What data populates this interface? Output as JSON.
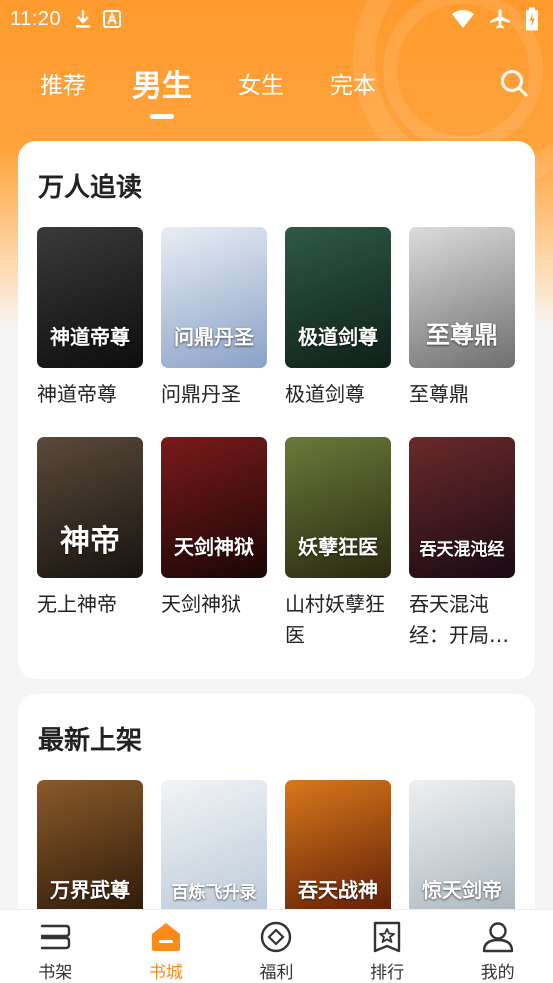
{
  "status_bar": {
    "time": "11:20",
    "left_icons": [
      "download-icon",
      "a-badge-icon"
    ],
    "right_icons": [
      "wifi-icon",
      "airplane-icon",
      "battery-icon"
    ]
  },
  "top_tabs": [
    {
      "label": "推荐",
      "active": false
    },
    {
      "label": "男生",
      "active": true
    },
    {
      "label": "女生",
      "active": false
    },
    {
      "label": "完本",
      "active": false
    }
  ],
  "colors": {
    "accent": "#ff8a1a",
    "header_gradient_top": "#ff9a2e",
    "background": "#f5f5f5"
  },
  "sections": [
    {
      "title": "万人追读",
      "books": [
        {
          "title": "神道帝尊",
          "cover_text": "神道帝尊",
          "cover_colors": [
            "#3a3a3a",
            "#0d0d0d"
          ]
        },
        {
          "title": "问鼎丹圣",
          "cover_text": "问鼎丹圣",
          "cover_colors": [
            "#e9eef4",
            "#8aa1c6"
          ]
        },
        {
          "title": "极道剑尊",
          "cover_text": "极道剑尊",
          "cover_colors": [
            "#2e5a46",
            "#0e2018"
          ]
        },
        {
          "title": "至尊鼎",
          "cover_text": "至尊鼎",
          "cover_colors": [
            "#dcdcdc",
            "#6f6f6f"
          ]
        },
        {
          "title": "无上神帝",
          "cover_text": "神帝",
          "cover_colors": [
            "#5a4a3a",
            "#181410"
          ]
        },
        {
          "title": "天剑神狱",
          "cover_text": "天剑神狱",
          "cover_colors": [
            "#7a1a1a",
            "#1a0606"
          ]
        },
        {
          "title": "山村妖孽狂医",
          "cover_text": "妖孽狂医",
          "cover_colors": [
            "#6a7a3a",
            "#2a2a10"
          ]
        },
        {
          "title": "吞天混沌经：开局…",
          "cover_text": "吞天混沌经",
          "cover_colors": [
            "#6a2a2a",
            "#1a0a14"
          ]
        }
      ]
    },
    {
      "title": "最新上架",
      "books": [
        {
          "title": "万界武尊",
          "cover_text": "万界武尊",
          "cover_colors": [
            "#8a5a2a",
            "#2a1808"
          ]
        },
        {
          "title": "百炼飞升录",
          "cover_text": "百炼飞升录",
          "cover_colors": [
            "#f2f4f6",
            "#b8c8d8"
          ]
        },
        {
          "title": "吞天战神",
          "cover_text": "吞天战神",
          "cover_colors": [
            "#d8781a",
            "#5a1a08"
          ]
        },
        {
          "title": "惊天剑帝",
          "cover_text": "惊天剑帝",
          "cover_colors": [
            "#eef0f2",
            "#a8b4bc"
          ]
        }
      ]
    }
  ],
  "bottom_nav": [
    {
      "label": "书架",
      "icon": "bookshelf-icon",
      "active": false
    },
    {
      "label": "书城",
      "icon": "bookstore-icon",
      "active": true
    },
    {
      "label": "福利",
      "icon": "welfare-icon",
      "active": false
    },
    {
      "label": "排行",
      "icon": "ranking-icon",
      "active": false
    },
    {
      "label": "我的",
      "icon": "profile-icon",
      "active": false
    }
  ]
}
